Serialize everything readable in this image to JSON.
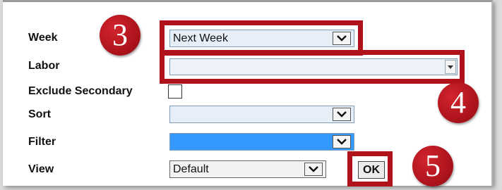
{
  "form": {
    "week": {
      "label": "Week",
      "value": "Next Week"
    },
    "labor": {
      "label": "Labor",
      "value": ""
    },
    "exclude_secondary": {
      "label": "Exclude Secondary",
      "checked": false
    },
    "sort": {
      "label": "Sort",
      "value": ""
    },
    "filter": {
      "label": "Filter",
      "value": ""
    },
    "view": {
      "label": "View",
      "value": "Default"
    },
    "ok_label": "OK"
  },
  "callouts": {
    "step3": "3",
    "step4": "4",
    "step5": "5"
  },
  "colors": {
    "callout_red": "#b0121b",
    "select_bg": "#e6eef8",
    "filter_highlight": "#3399ff"
  }
}
